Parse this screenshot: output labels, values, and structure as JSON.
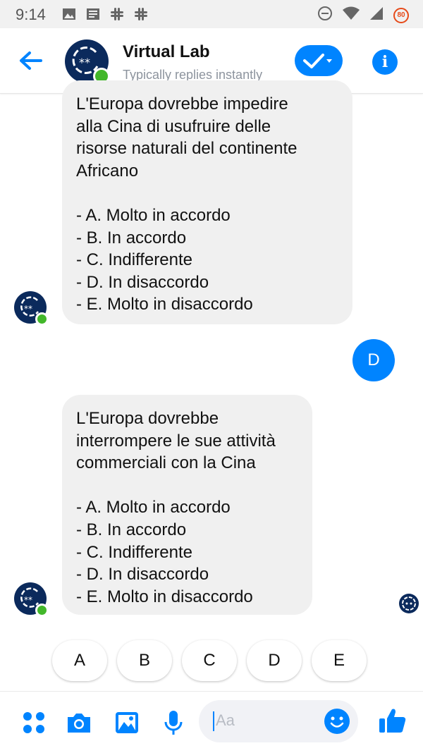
{
  "status_bar": {
    "time": "9:14",
    "battery_badge": "80"
  },
  "header": {
    "title": "Virtual Lab",
    "subtitle": "Typically replies instantly",
    "back_icon": "arrow-left-icon",
    "confirm_icon": "check-dropdown-icon",
    "info_icon": "info-icon",
    "info_glyph": "i"
  },
  "messages": [
    {
      "from": "bot",
      "text": "L'Europa dovrebbe impedire\nalla Cina di usufruire delle\nrisorse naturali del continente\nAfricano\n\n- A. Molto in accordo\n- B. In accordo\n- C. Indifferente\n- D. In disaccordo\n- E. Molto in disaccordo"
    },
    {
      "from": "user",
      "text": "D"
    },
    {
      "from": "bot",
      "text": "L'Europa dovrebbe\ninterrompere le sue attività\ncommerciali con la Cina\n\n- A. Molto in accordo\n- B. In accordo\n- C. Indifferente\n- D. In disaccordo\n- E. Molto in disaccordo"
    }
  ],
  "quick_replies": [
    "A",
    "B",
    "C",
    "D",
    "E"
  ],
  "composer": {
    "placeholder": "Aa"
  },
  "colors": {
    "accent": "#0084ff",
    "bubble": "#f0f0f0",
    "online": "#42b72a",
    "avatar": "#0b2a5c"
  }
}
